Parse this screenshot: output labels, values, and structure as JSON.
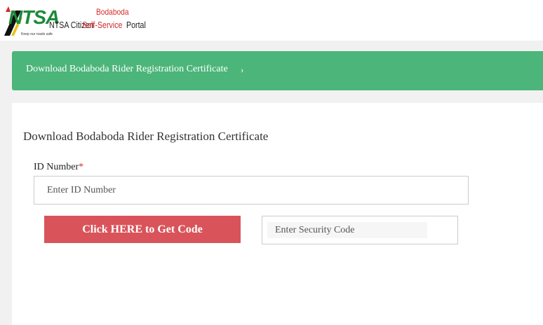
{
  "header": {
    "logo": {
      "ntsa": "NTSA",
      "tagline": "Keep our roads safe",
      "text_citizen": "NTSA Citizen",
      "text_bodaboda": "Bodaboda",
      "text_self_service": "Self-Service",
      "text_portal": "Portal"
    }
  },
  "banner": {
    "label": "Download Bodaboda Rider Registration Certificate",
    "chevron": "›",
    "color": "#4cb57a"
  },
  "form": {
    "title": "Download Bodaboda Rider Registration Certificate",
    "id_label": "ID Number",
    "id_required_mark": "*",
    "id_placeholder": "Enter ID Number",
    "get_code_button": "Click HERE to Get Code",
    "get_code_button_color": "#d9545a",
    "security_placeholder": "Enter Security Code"
  }
}
